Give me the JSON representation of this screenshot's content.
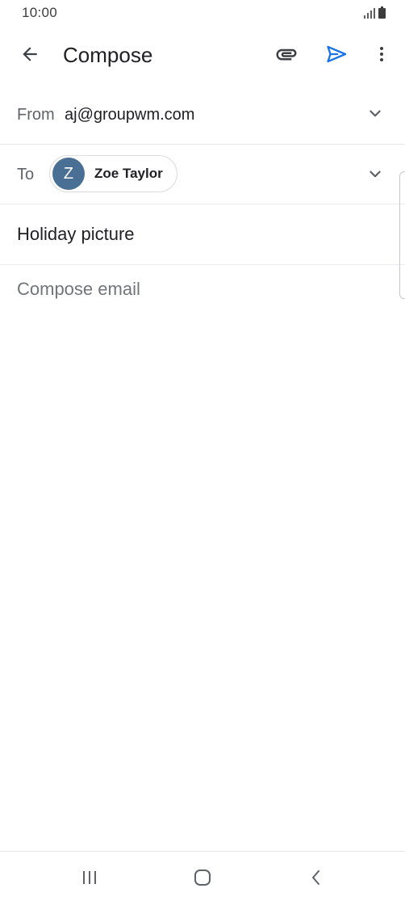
{
  "status_bar": {
    "time": "10:00",
    "icons": [
      "signal-icon",
      "battery-icon"
    ]
  },
  "app_bar": {
    "title": "Compose",
    "icons": {
      "back": "arrow-back-icon",
      "attach": "paperclip-icon",
      "send": "send-icon",
      "more": "more-vert-icon"
    },
    "accent_color": "#1a73e8"
  },
  "from": {
    "label": "From",
    "value": "aj@groupwm.com"
  },
  "to": {
    "label": "To",
    "recipient": {
      "initial": "Z",
      "name": "Zoe Taylor",
      "avatar_color": "#4a6f94"
    }
  },
  "subject": {
    "value": "Holiday picture"
  },
  "body": {
    "placeholder": "Compose email"
  },
  "nav_bar": {
    "icons": [
      "recent-apps-icon",
      "home-icon",
      "nav-back-icon"
    ]
  }
}
